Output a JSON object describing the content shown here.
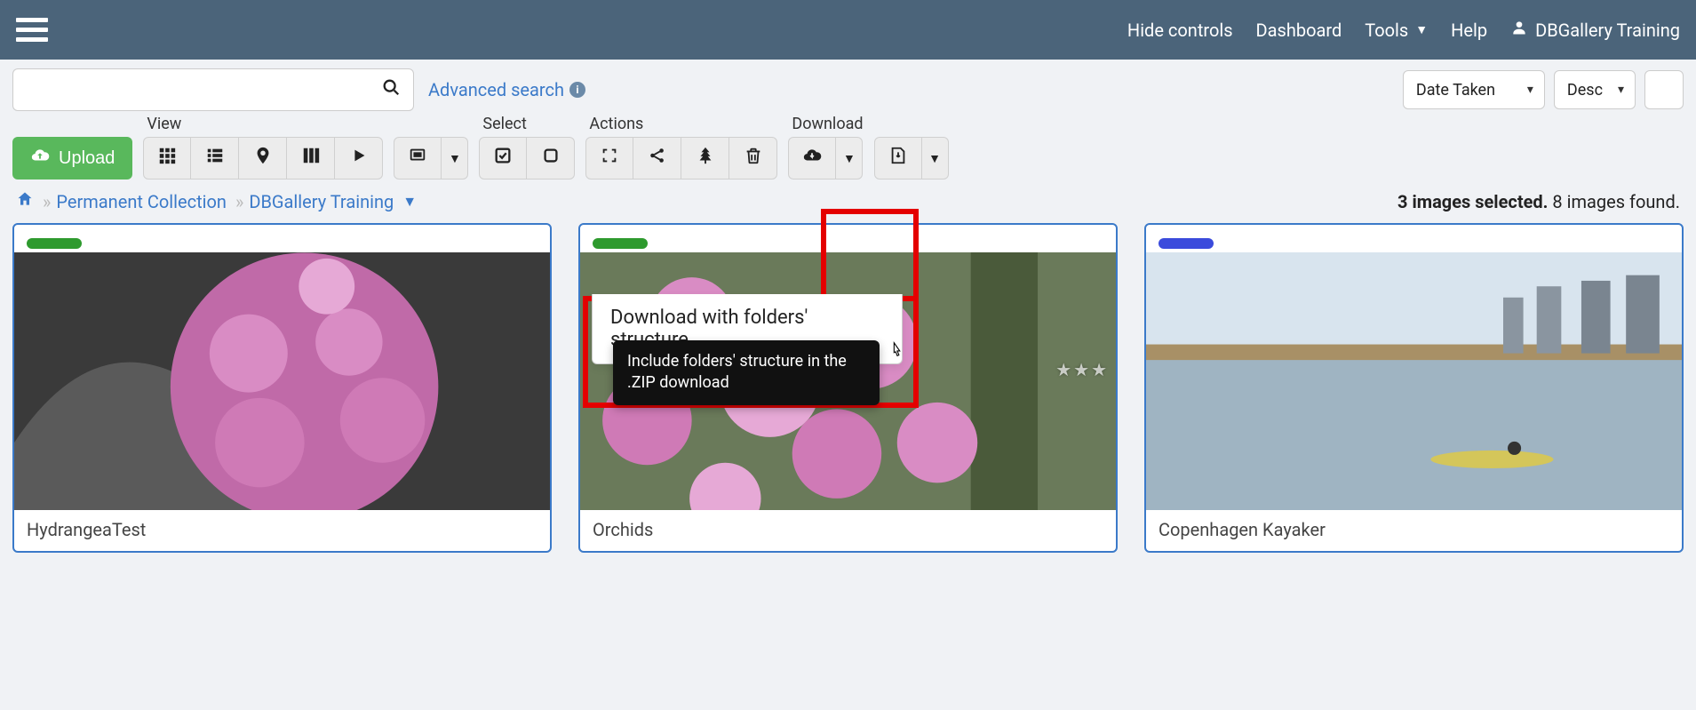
{
  "topbar": {
    "hide_controls": "Hide controls",
    "dashboard": "Dashboard",
    "tools": "Tools",
    "help": "Help",
    "user": "DBGallery Training"
  },
  "search": {
    "placeholder": "",
    "value": "",
    "advanced_label": "Advanced search"
  },
  "sort": {
    "field": "Date Taken",
    "direction": "Desc"
  },
  "upload_label": "Upload",
  "toolbar": {
    "view_label": "View",
    "select_label": "Select",
    "actions_label": "Actions",
    "download_label": "Download"
  },
  "breadcrumbs": {
    "items": [
      "Permanent Collection",
      "DBGallery Training"
    ]
  },
  "status": {
    "selected_prefix": "3 images selected.",
    "found_suffix": " 8 images found."
  },
  "dropdown": {
    "item_label": "Download with folders' structure",
    "tooltip": "Include folders' structure in the .ZIP download"
  },
  "cards": [
    {
      "title": "HydrangeaTest",
      "badge": "green"
    },
    {
      "title": "Orchids",
      "badge": "green"
    },
    {
      "title": "Copenhagen Kayaker",
      "badge": "blue"
    }
  ]
}
